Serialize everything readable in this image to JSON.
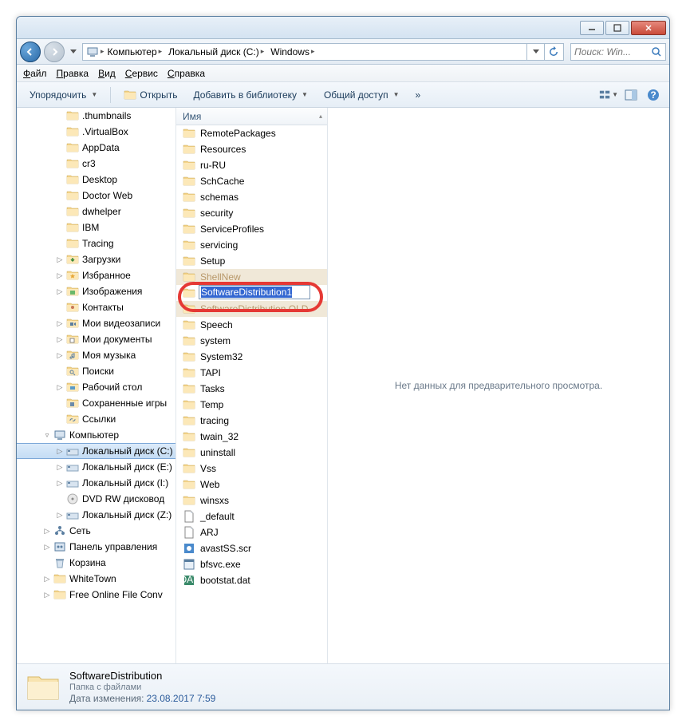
{
  "titlebar": {
    "minimize": "_",
    "maximize": "□",
    "close": "×"
  },
  "breadcrumb": {
    "segments": [
      "Компьютер",
      "Локальный диск (C:)",
      "Windows"
    ]
  },
  "search": {
    "placeholder": "Поиск: Win..."
  },
  "menubar": [
    "Файл",
    "Правка",
    "Вид",
    "Сервис",
    "Справка"
  ],
  "toolbar": {
    "organize": "Упорядочить",
    "open": "Открыть",
    "library": "Добавить в библиотеку",
    "share": "Общий доступ",
    "more": "»"
  },
  "tree": [
    {
      "i": 2,
      "icon": "folder",
      "label": ".thumbnails"
    },
    {
      "i": 2,
      "icon": "folder",
      "label": ".VirtualBox"
    },
    {
      "i": 2,
      "icon": "folder",
      "label": "AppData"
    },
    {
      "i": 2,
      "icon": "folder",
      "label": "cr3"
    },
    {
      "i": 2,
      "icon": "folder",
      "label": "Desktop"
    },
    {
      "i": 2,
      "icon": "folder",
      "label": "Doctor Web"
    },
    {
      "i": 2,
      "icon": "folder",
      "label": "dwhelper"
    },
    {
      "i": 2,
      "icon": "folder",
      "label": "IBM"
    },
    {
      "i": 2,
      "icon": "folder",
      "label": "Tracing"
    },
    {
      "i": 2,
      "icon": "dl",
      "label": "Загрузки",
      "exp": "▷"
    },
    {
      "i": 2,
      "icon": "star",
      "label": "Избранное",
      "exp": "▷"
    },
    {
      "i": 2,
      "icon": "pic",
      "label": "Изображения",
      "exp": "▷"
    },
    {
      "i": 2,
      "icon": "contact",
      "label": "Контакты"
    },
    {
      "i": 2,
      "icon": "vid",
      "label": "Мои видеозаписи",
      "exp": "▷"
    },
    {
      "i": 2,
      "icon": "doc",
      "label": "Мои документы",
      "exp": "▷"
    },
    {
      "i": 2,
      "icon": "music",
      "label": "Моя музыка",
      "exp": "▷"
    },
    {
      "i": 2,
      "icon": "search",
      "label": "Поиски"
    },
    {
      "i": 2,
      "icon": "desktop",
      "label": "Рабочий стол",
      "exp": "▷"
    },
    {
      "i": 2,
      "icon": "save",
      "label": "Сохраненные игры"
    },
    {
      "i": 2,
      "icon": "link",
      "label": "Ссылки"
    },
    {
      "i": 1,
      "icon": "computer",
      "label": "Компьютер",
      "exp": "▿"
    },
    {
      "i": 2,
      "icon": "drive",
      "label": "Локальный диск (C:)",
      "exp": "▷",
      "sel": true
    },
    {
      "i": 2,
      "icon": "drive",
      "label": "Локальный диск (E:)",
      "exp": "▷"
    },
    {
      "i": 2,
      "icon": "drive",
      "label": "Локальный диск (I:)",
      "exp": "▷"
    },
    {
      "i": 2,
      "icon": "dvd",
      "label": "DVD RW дисковод"
    },
    {
      "i": 2,
      "icon": "drive",
      "label": "Локальный диск (Z:)",
      "exp": "▷"
    },
    {
      "i": 1,
      "icon": "network",
      "label": "Сеть",
      "exp": "▷"
    },
    {
      "i": 1,
      "icon": "cpanel",
      "label": "Панель управления",
      "exp": "▷"
    },
    {
      "i": 1,
      "icon": "trash",
      "label": "Корзина"
    },
    {
      "i": 1,
      "icon": "folder",
      "label": "WhiteTown",
      "exp": "▷"
    },
    {
      "i": 1,
      "icon": "folder",
      "label": "Free Online File Conv",
      "exp": "▷"
    }
  ],
  "filelist": {
    "header": "Имя",
    "rename_value": "SoftwareDistribution1",
    "items": [
      {
        "icon": "folder",
        "name": "RemotePackages"
      },
      {
        "icon": "folder",
        "name": "Resources"
      },
      {
        "icon": "folder",
        "name": "ru-RU"
      },
      {
        "icon": "folder",
        "name": "SchCache"
      },
      {
        "icon": "folder",
        "name": "schemas"
      },
      {
        "icon": "folder",
        "name": "security"
      },
      {
        "icon": "folder",
        "name": "ServiceProfiles"
      },
      {
        "icon": "folder",
        "name": "servicing"
      },
      {
        "icon": "folder",
        "name": "Setup"
      },
      {
        "icon": "folder",
        "name": "ShellNew",
        "dim": true
      },
      {
        "icon": "folder",
        "name": "",
        "rename": true
      },
      {
        "icon": "folder",
        "name": "SoftwareDistribution.OLD",
        "dim": true
      },
      {
        "icon": "folder",
        "name": "Speech"
      },
      {
        "icon": "folder",
        "name": "system"
      },
      {
        "icon": "folder",
        "name": "System32"
      },
      {
        "icon": "folder",
        "name": "TAPI"
      },
      {
        "icon": "folder",
        "name": "Tasks"
      },
      {
        "icon": "folder",
        "name": "Temp"
      },
      {
        "icon": "folder",
        "name": "tracing"
      },
      {
        "icon": "folder",
        "name": "twain_32"
      },
      {
        "icon": "folder",
        "name": "uninstall"
      },
      {
        "icon": "folder",
        "name": "Vss"
      },
      {
        "icon": "folder",
        "name": "Web"
      },
      {
        "icon": "folder",
        "name": "winsxs"
      },
      {
        "icon": "file",
        "name": "_default"
      },
      {
        "icon": "file",
        "name": "ARJ"
      },
      {
        "icon": "scr",
        "name": "avastSS.scr"
      },
      {
        "icon": "exe",
        "name": "bfsvc.exe"
      },
      {
        "icon": "dat",
        "name": "bootstat.dat"
      }
    ]
  },
  "preview": {
    "empty": "Нет данных для предварительного просмотра."
  },
  "details": {
    "title": "SoftwareDistribution",
    "subtitle": "Папка с файлами",
    "meta_label": "Дата изменения:",
    "meta_value": "23.08.2017 7:59"
  }
}
